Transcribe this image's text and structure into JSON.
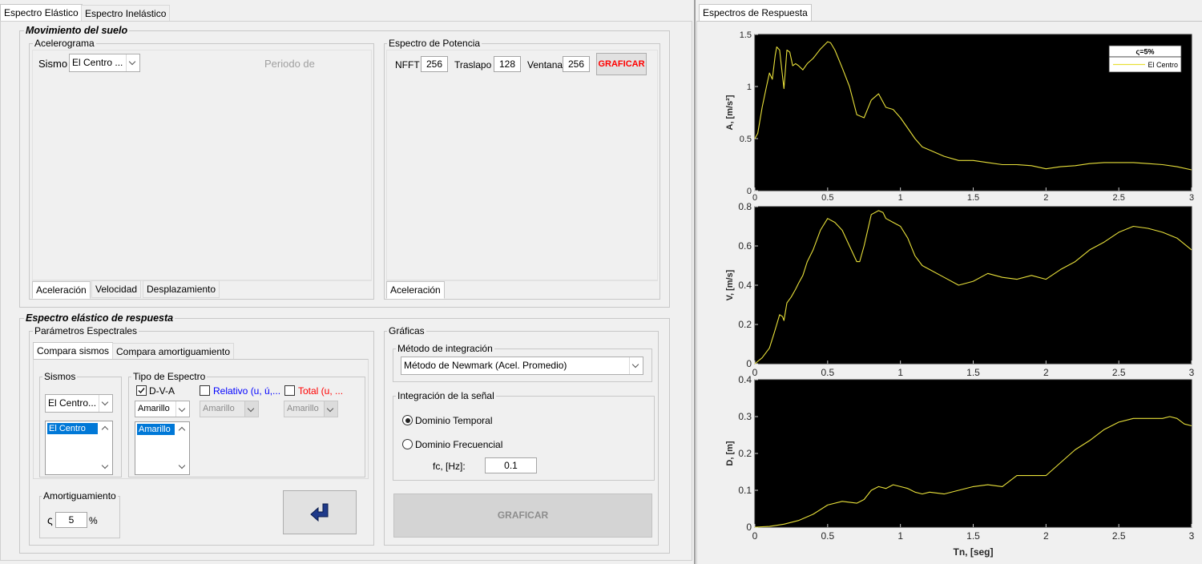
{
  "left_tabs": [
    "Espectro Elástico",
    "Espectro Inelástico"
  ],
  "right_tab": "Espectros de Respuesta",
  "movimiento": {
    "title": "Movimiento del suelo",
    "acelerograma": {
      "title": "Acelerograma",
      "sismo_label": "Sismo",
      "sismo_value": "El Centro   ...",
      "periodo_label": "Periodo de",
      "tabs": [
        "Aceleración",
        "Velocidad",
        "Desplazamiento"
      ]
    },
    "potencia": {
      "title": "Espectro de Potencia",
      "nfft_label": "NFFT",
      "nfft_value": "256",
      "traslapo_label": "Traslapo",
      "traslapo_value": "128",
      "ventana_label": "Ventana",
      "ventana_value": "256",
      "graficar": "GRAFICAR",
      "tab": "Aceleración"
    }
  },
  "elastico": {
    "title": "Espectro elástico de respuesta",
    "parametros": {
      "title": "Parámetros Espectrales",
      "tabs": [
        "Compara sismos",
        "Compara amortiguamiento"
      ],
      "sismos": {
        "title": "Sismos",
        "combo": "El Centro...",
        "list": [
          "El Centro"
        ]
      },
      "tipo": {
        "title": "Tipo de Espectro",
        "dva_label": "D-V-A",
        "dva_checked": true,
        "relativo_label": "Relativo (u, ú,...",
        "total_label": "Total (u, ...",
        "dva_color": "Amarillo",
        "relativo_color": "Amarillo",
        "total_color": "Amarillo",
        "list": [
          "Amarillo"
        ]
      },
      "amortiguamiento": {
        "title": "Amortiguamiento",
        "symbol": "ς",
        "value": "5",
        "unit": "%"
      }
    },
    "graficas": {
      "title": "Gráficas",
      "metodo": {
        "title": "Método de integración",
        "value": "Método de Newmark (Acel. Promedio)"
      },
      "integracion": {
        "title": "Integración de la señal",
        "temporal": "Dominio Temporal",
        "frecuencial": "Dominio Frecuencial",
        "selected": "temporal",
        "fc_label": "fc, [Hz]:",
        "fc_value": "0.1"
      },
      "graficar": "GRAFICAR"
    }
  },
  "colors": {
    "plot_bg": "#000000",
    "curve": "#e8e03a",
    "relativo_text": "#0000ff",
    "total_text": "#ff0000",
    "graficar_red": "#ff0000",
    "selection": "#0078d7",
    "enter_icon": "#1f3a8a"
  },
  "chart_data": [
    {
      "type": "line",
      "ylabel": "A, [m/s²]",
      "xlim": [
        0,
        3
      ],
      "ylim": [
        0,
        1.5
      ],
      "xticks": [
        "0",
        "0.5",
        "1",
        "1.5",
        "2",
        "2.5",
        "3"
      ],
      "yticks": [
        "0",
        "0.5",
        "1",
        "1.5"
      ],
      "legend": {
        "header": "ς=5%",
        "entries": [
          "El Centro"
        ],
        "placement": "top-right"
      },
      "series": [
        {
          "name": "El Centro",
          "x": [
            0,
            0.02,
            0.05,
            0.08,
            0.1,
            0.12,
            0.14,
            0.15,
            0.17,
            0.19,
            0.2,
            0.22,
            0.24,
            0.26,
            0.28,
            0.3,
            0.33,
            0.36,
            0.4,
            0.45,
            0.5,
            0.52,
            0.55,
            0.6,
            0.65,
            0.7,
            0.75,
            0.8,
            0.85,
            0.9,
            0.95,
            1.0,
            1.05,
            1.1,
            1.15,
            1.2,
            1.3,
            1.4,
            1.5,
            1.6,
            1.7,
            1.8,
            1.9,
            2.0,
            2.1,
            2.2,
            2.3,
            2.4,
            2.5,
            2.6,
            2.7,
            2.8,
            2.9,
            3.0
          ],
          "y": [
            0.5,
            0.55,
            0.8,
            1.0,
            1.13,
            1.07,
            1.3,
            1.38,
            1.35,
            1.1,
            0.98,
            1.35,
            1.33,
            1.2,
            1.22,
            1.2,
            1.16,
            1.22,
            1.27,
            1.36,
            1.43,
            1.42,
            1.35,
            1.18,
            1.0,
            0.73,
            0.7,
            0.87,
            0.93,
            0.8,
            0.78,
            0.7,
            0.6,
            0.5,
            0.42,
            0.39,
            0.33,
            0.29,
            0.29,
            0.27,
            0.25,
            0.25,
            0.24,
            0.21,
            0.23,
            0.24,
            0.26,
            0.27,
            0.27,
            0.27,
            0.26,
            0.25,
            0.23,
            0.2
          ]
        }
      ]
    },
    {
      "type": "line",
      "ylabel": "V, [m/s]",
      "xlim": [
        0,
        3
      ],
      "ylim": [
        0,
        0.8
      ],
      "xticks": [
        "0",
        "0.5",
        "1",
        "1.5",
        "2",
        "2.5",
        "3"
      ],
      "yticks": [
        "0",
        "0.2",
        "0.4",
        "0.6",
        "0.8"
      ],
      "series": [
        {
          "name": "El Centro",
          "x": [
            0,
            0.05,
            0.1,
            0.13,
            0.15,
            0.17,
            0.19,
            0.2,
            0.22,
            0.25,
            0.28,
            0.3,
            0.33,
            0.36,
            0.4,
            0.45,
            0.5,
            0.55,
            0.6,
            0.65,
            0.7,
            0.72,
            0.75,
            0.8,
            0.85,
            0.88,
            0.9,
            0.95,
            1.0,
            1.05,
            1.1,
            1.15,
            1.2,
            1.3,
            1.4,
            1.5,
            1.6,
            1.7,
            1.8,
            1.9,
            2.0,
            2.1,
            2.2,
            2.3,
            2.4,
            2.5,
            2.6,
            2.7,
            2.8,
            2.9,
            3.0
          ],
          "y": [
            0,
            0.03,
            0.08,
            0.15,
            0.2,
            0.25,
            0.24,
            0.22,
            0.31,
            0.34,
            0.38,
            0.41,
            0.45,
            0.52,
            0.58,
            0.68,
            0.74,
            0.72,
            0.68,
            0.6,
            0.52,
            0.52,
            0.6,
            0.76,
            0.78,
            0.77,
            0.74,
            0.72,
            0.7,
            0.64,
            0.55,
            0.5,
            0.48,
            0.44,
            0.4,
            0.42,
            0.46,
            0.44,
            0.43,
            0.45,
            0.43,
            0.48,
            0.52,
            0.58,
            0.62,
            0.67,
            0.7,
            0.69,
            0.67,
            0.64,
            0.58
          ]
        }
      ]
    },
    {
      "type": "line",
      "ylabel": "D, [m]",
      "xlabel": "Tn, [seg]",
      "xlim": [
        0,
        3
      ],
      "ylim": [
        0,
        0.4
      ],
      "xticks": [
        "0",
        "0.5",
        "1",
        "1.5",
        "2",
        "2.5",
        "3"
      ],
      "yticks": [
        "0",
        "0.1",
        "0.2",
        "0.3",
        "0.4"
      ],
      "series": [
        {
          "name": "El Centro",
          "x": [
            0,
            0.1,
            0.2,
            0.3,
            0.4,
            0.5,
            0.6,
            0.7,
            0.75,
            0.8,
            0.85,
            0.9,
            0.95,
            1.0,
            1.05,
            1.1,
            1.15,
            1.2,
            1.3,
            1.4,
            1.5,
            1.6,
            1.7,
            1.8,
            1.9,
            2.0,
            2.1,
            2.2,
            2.3,
            2.4,
            2.5,
            2.6,
            2.7,
            2.8,
            2.85,
            2.9,
            2.95,
            3.0
          ],
          "y": [
            0,
            0.002,
            0.008,
            0.018,
            0.035,
            0.06,
            0.07,
            0.065,
            0.075,
            0.1,
            0.11,
            0.105,
            0.115,
            0.11,
            0.105,
            0.095,
            0.09,
            0.095,
            0.09,
            0.1,
            0.11,
            0.115,
            0.11,
            0.14,
            0.14,
            0.14,
            0.175,
            0.21,
            0.235,
            0.265,
            0.285,
            0.295,
            0.295,
            0.295,
            0.3,
            0.295,
            0.28,
            0.275
          ]
        }
      ]
    }
  ]
}
